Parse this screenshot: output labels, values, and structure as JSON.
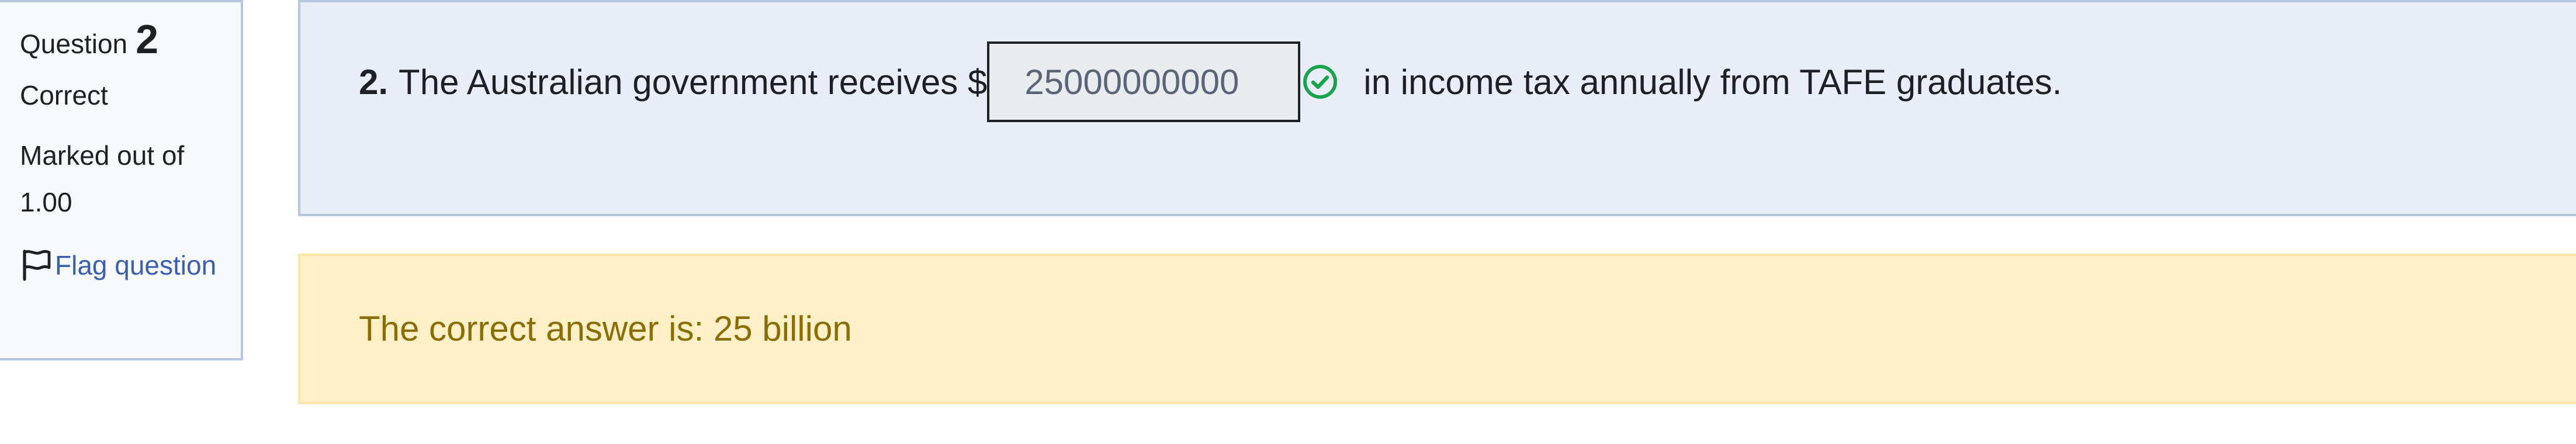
{
  "info": {
    "question_label": "Question",
    "question_number": "2",
    "state": "Correct",
    "grade": "Marked out of 1.00",
    "flag_label": "Flag question"
  },
  "question": {
    "number": "2.",
    "text_before": "The Australian government receives $",
    "answer_value": "25000000000",
    "text_after": "in income tax annually from TAFE graduates."
  },
  "feedback": {
    "right_answer": "The correct answer is: 25 billion"
  },
  "colors": {
    "correct_icon": "#1aa34a",
    "feedback_text": "#8a6d04",
    "link": "#3a5fb0"
  },
  "icons": {
    "flag": "flag-outline-icon",
    "correct": "check-circle-icon"
  }
}
